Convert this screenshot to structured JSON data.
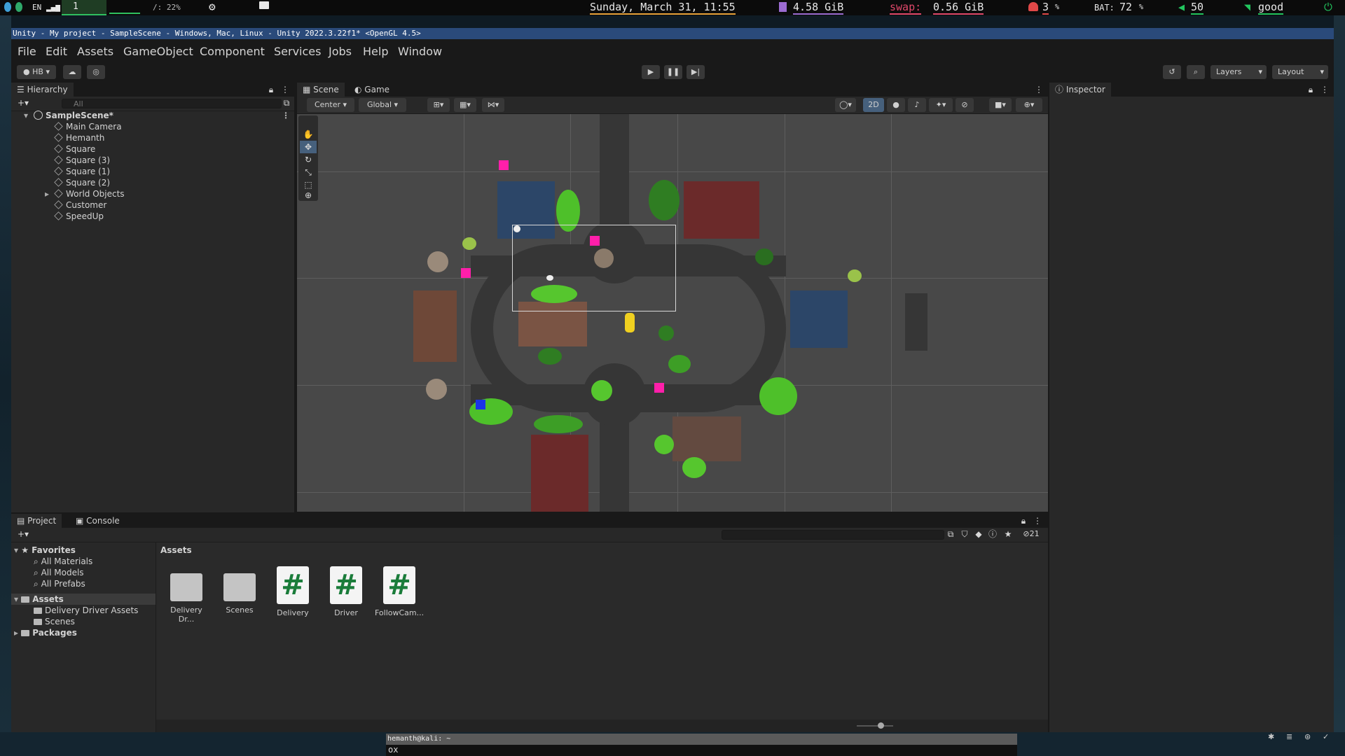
{
  "systembar": {
    "lang": "EN",
    "workspace": "1",
    "cpu": "/: 22%",
    "datetime": "Sunday, March 31, 11:55",
    "mem": "4.58 GiB",
    "swap_label": "swap:",
    "swap_value": "0.56 GiB",
    "temp": "3",
    "temp_unit": "%",
    "bat_label": "BAT:",
    "bat_value": "72",
    "bat_unit": "%",
    "volume": "50",
    "wifi": "good",
    "colors": {
      "mem": "#9b6bd1",
      "swap": "#e0486a",
      "temp": "#e04848",
      "volume": "#22c55e",
      "wifi": "#22c55e",
      "datetime": "#e8a23a"
    }
  },
  "window": {
    "title": "Unity - My project - SampleScene - Windows, Mac, Linux - Unity 2022.3.22f1* <OpenGL 4.5>"
  },
  "menu": [
    "File",
    "Edit",
    "Assets",
    "GameObject",
    "Component",
    "Services",
    "Jobs",
    "Help",
    "Window"
  ],
  "toolbar": {
    "account": "HB",
    "layers": "Layers",
    "layout": "Layout"
  },
  "hierarchy": {
    "tab": "Hierarchy",
    "search_placeholder": "All",
    "scene": "SampleScene*",
    "items": [
      "Main Camera",
      "Hemanth",
      "Square",
      "Square (3)",
      "Square (1)",
      "Square (2)",
      "World Objects",
      "Customer",
      "SpeedUp"
    ]
  },
  "scene_tabs": {
    "scene": "Scene",
    "game": "Game",
    "pivot": "Center",
    "space": "Global",
    "mode2d": "2D"
  },
  "inspector": {
    "tab": "Inspector"
  },
  "project": {
    "tab_project": "Project",
    "tab_console": "Console",
    "hidden_count": "21",
    "favorites_label": "Favorites",
    "favorites": [
      "All Materials",
      "All Models",
      "All Prefabs"
    ],
    "assets_root": "Assets",
    "assets_children": [
      "Delivery Driver Assets",
      "Scenes"
    ],
    "packages": "Packages",
    "breadcrumb": "Assets",
    "tiles": [
      {
        "name": "Delivery Dr...",
        "kind": "folder"
      },
      {
        "name": "Scenes",
        "kind": "folder"
      },
      {
        "name": "Delivery",
        "kind": "script"
      },
      {
        "name": "Driver",
        "kind": "script"
      },
      {
        "name": "FollowCam...",
        "kind": "script"
      }
    ],
    "script_glyph": "#"
  },
  "terminal": {
    "title": "hemanth@kali: ~",
    "line": "ox"
  }
}
